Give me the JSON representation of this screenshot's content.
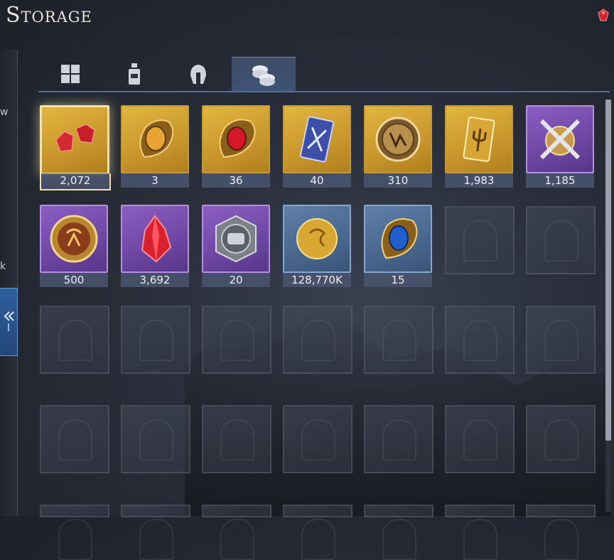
{
  "header": {
    "title": "Storage"
  },
  "tabs": [
    {
      "name": "all-items-tab",
      "icon": "grid-icon"
    },
    {
      "name": "consumables-tab",
      "icon": "bottle-icon"
    },
    {
      "name": "equipment-tab",
      "icon": "helmet-icon"
    },
    {
      "name": "currency-tab",
      "icon": "coins-icon",
      "active": true
    }
  ],
  "left_panel": {
    "fragment_1": "w",
    "fragment_2": "k",
    "tab_letter": "l"
  },
  "items": [
    {
      "name": "red-gems",
      "rarity": "gold",
      "count": "2,072",
      "icon": "red-gem-icon",
      "selected": true
    },
    {
      "name": "amber-emblem",
      "rarity": "gold",
      "count": "3",
      "icon": "amber-crest-icon"
    },
    {
      "name": "ruby-emblem",
      "rarity": "gold",
      "count": "36",
      "icon": "ruby-crest-icon"
    },
    {
      "name": "sword-card",
      "rarity": "gold",
      "count": "40",
      "icon": "sword-card-icon"
    },
    {
      "name": "seal-coin",
      "rarity": "gold",
      "count": "310",
      "icon": "seal-coin-icon"
    },
    {
      "name": "trident-card",
      "rarity": "gold",
      "count": "1,983",
      "icon": "trident-card-icon"
    },
    {
      "name": "crossed-swords",
      "rarity": "purple",
      "count": "1,185",
      "icon": "crossed-swords-icon"
    },
    {
      "name": "crest-coin",
      "rarity": "purple",
      "count": "500",
      "icon": "crest-coin-icon"
    },
    {
      "name": "red-crystal",
      "rarity": "purple",
      "count": "3,692",
      "icon": "red-crystal-icon"
    },
    {
      "name": "fist-medal",
      "rarity": "purple",
      "count": "20",
      "icon": "fist-medal-icon"
    },
    {
      "name": "gold-coin",
      "rarity": "blue",
      "count": "128,770K",
      "icon": "gold-coin-icon"
    },
    {
      "name": "sapphire-emblem",
      "rarity": "blue",
      "count": "15",
      "icon": "sapphire-crest-icon"
    }
  ],
  "colors": {
    "gold": "#c8962b",
    "purple": "#6d46a3",
    "blue": "#49678e",
    "tab_accent": "#4f6e9f"
  }
}
